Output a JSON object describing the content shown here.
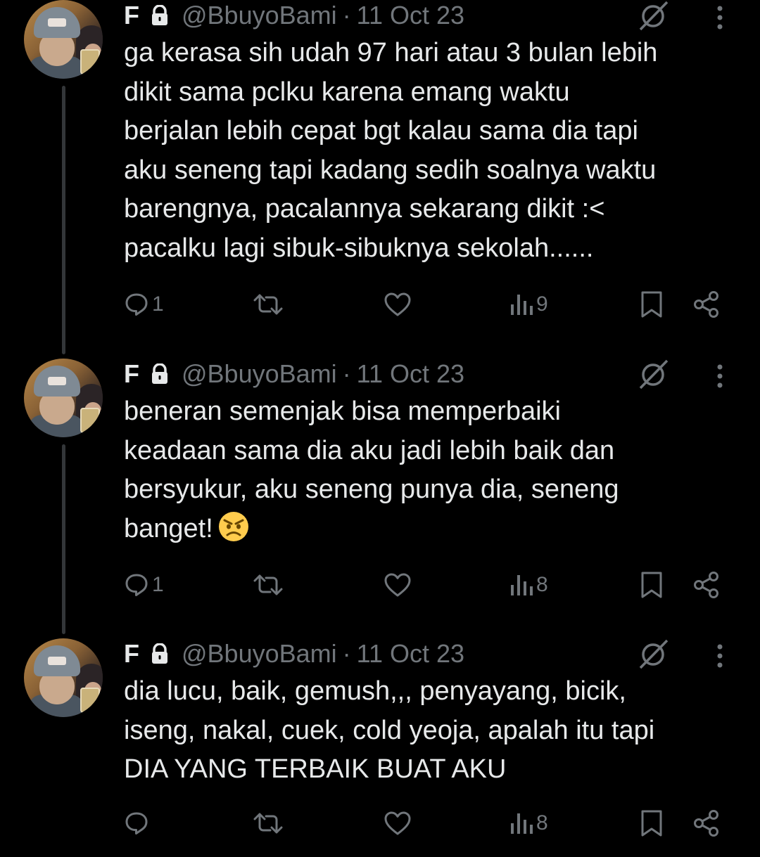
{
  "colors": {
    "background": "#000000",
    "text": "#e7e9ea",
    "muted": "#71767b",
    "thread_line": "#333639",
    "emoji_face": "#ffcc4d"
  },
  "tweets": [
    {
      "display_name": "F",
      "handle": "@BbuyoBami",
      "separator": "·",
      "date": "11 Oct 23",
      "text": "ga kerasa sih udah 97 hari atau 3 bulan lebih\ndikit sama pclku karena emang waktu\nberjalan lebih cepat bgt kalau sama dia tapi\naku seneng tapi kadang sedih soalnya waktu\nbarengnya, pacalannya sekarang dikit :<\npacalku lagi sibuk-sibuknya sekolah......",
      "reply_count": "1",
      "retweet_count": "",
      "like_count": "",
      "view_count": "9",
      "icons": [
        "lock-icon",
        "grok-icon",
        "more-icon",
        "reply-icon",
        "retweet-icon",
        "like-icon",
        "views-icon",
        "bookmark-icon",
        "share-icon"
      ]
    },
    {
      "display_name": "F",
      "handle": "@BbuyoBami",
      "separator": "·",
      "date": "11 Oct 23",
      "text": "beneran semenjak bisa memperbaiki\nkeadaan sama dia aku jadi lebih baik dan\nbersyukur, aku seneng punya dia, seneng\nbanget!",
      "emoji": "😠",
      "reply_count": "1",
      "retweet_count": "",
      "like_count": "",
      "view_count": "8"
    },
    {
      "display_name": "F",
      "handle": "@BbuyoBami",
      "separator": "·",
      "date": "11 Oct 23",
      "text": "dia lucu, baik, gemush,,, penyayang, bicik,\niseng, nakal, cuek, cold yeoja, apalah itu tapi\nDIA YANG TERBAIK BUAT AKU",
      "reply_count": "",
      "retweet_count": "",
      "like_count": "",
      "view_count": "8"
    }
  ]
}
